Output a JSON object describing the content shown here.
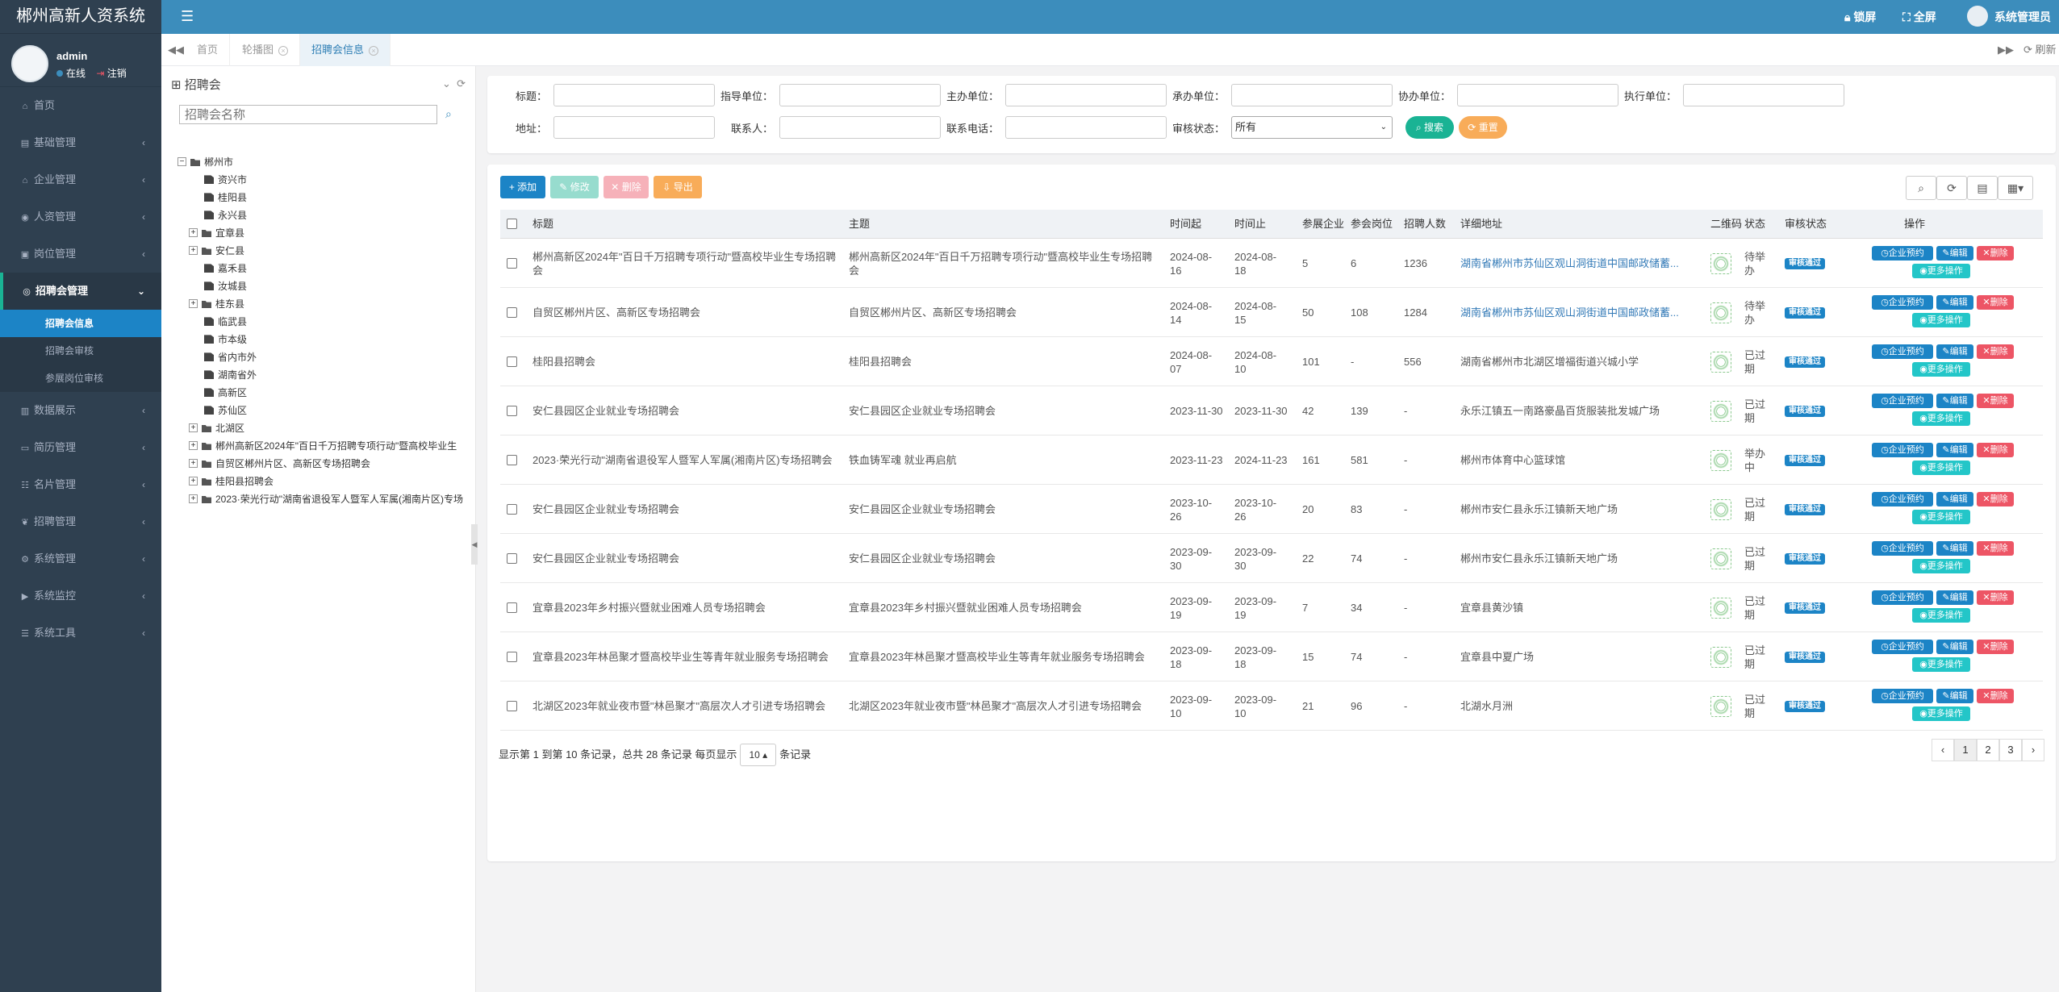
{
  "app": {
    "title": "郴州高新人资系统"
  },
  "header": {
    "menu_icon": "bars-icon",
    "lock_label": "锁屏",
    "fullscreen_label": "全屏",
    "user_label": "系统管理员"
  },
  "user": {
    "name": "admin",
    "status": "在线",
    "logout": "注销"
  },
  "sidebar": {
    "home": "首页",
    "items": [
      {
        "label": "基础管理",
        "icon": "building-icon"
      },
      {
        "label": "企业管理",
        "icon": "bank-icon"
      },
      {
        "label": "人资管理",
        "icon": "user-circle-icon"
      },
      {
        "label": "岗位管理",
        "icon": "briefcase-icon"
      },
      {
        "label": "招聘会管理",
        "icon": "eye-icon"
      },
      {
        "label": "数据展示",
        "icon": "bar-chart-icon"
      },
      {
        "label": "简历管理",
        "icon": "id-card-icon"
      },
      {
        "label": "名片管理",
        "icon": "users-icon"
      },
      {
        "label": "招聘管理",
        "icon": "leaf-icon"
      },
      {
        "label": "系统管理",
        "icon": "gear-icon"
      },
      {
        "label": "系统监控",
        "icon": "video-icon"
      },
      {
        "label": "系统工具",
        "icon": "list-icon"
      }
    ],
    "sub_items": [
      "招聘会信息",
      "招聘会审核",
      "参展岗位审核"
    ]
  },
  "tabs": {
    "items": [
      "首页",
      "轮播图",
      "招聘会信息"
    ],
    "refresh": "刷新"
  },
  "tree": {
    "title": "招聘会",
    "search_placeholder": "招聘会名称",
    "root": "郴州市",
    "nodes": [
      {
        "label": "资兴市",
        "folder": false
      },
      {
        "label": "桂阳县",
        "folder": false
      },
      {
        "label": "永兴县",
        "folder": false
      },
      {
        "label": "宜章县",
        "folder": true
      },
      {
        "label": "安仁县",
        "folder": true
      },
      {
        "label": "嘉禾县",
        "folder": false
      },
      {
        "label": "汝城县",
        "folder": false
      },
      {
        "label": "桂东县",
        "folder": true
      },
      {
        "label": "临武县",
        "folder": false
      },
      {
        "label": "市本级",
        "folder": false
      },
      {
        "label": "省内市外",
        "folder": false
      },
      {
        "label": "湖南省外",
        "folder": false
      },
      {
        "label": "高新区",
        "folder": false
      },
      {
        "label": "苏仙区",
        "folder": false
      },
      {
        "label": "北湖区",
        "folder": true
      }
    ],
    "roots2": [
      "郴州高新区2024年\"百日千万招聘专项行动\"暨高校毕业生",
      "自贸区郴州片区、高新区专场招聘会",
      "桂阳县招聘会",
      "2023·荣光行动\"湖南省退役军人暨军人军属(湘南片区)专场"
    ]
  },
  "search": {
    "labels": {
      "title": "标题：",
      "guide": "指导单位：",
      "host": "主办单位：",
      "undertake": "承办单位：",
      "assist": "协办单位：",
      "execute": "执行单位：",
      "address": "地址：",
      "contact": "联系人：",
      "phone": "联系电话：",
      "status": "审核状态："
    },
    "status_value": "所有",
    "search_btn": "搜索",
    "reset_btn": "重置"
  },
  "toolbar": {
    "add": "添加",
    "edit": "修改",
    "delete": "删除",
    "export": "导出"
  },
  "table": {
    "headers": [
      "标题",
      "主题",
      "时间起",
      "时间止",
      "参展企业",
      "参会岗位",
      "招聘人数",
      "详细地址",
      "二维码",
      "状态",
      "审核状态",
      "操作"
    ],
    "rows": [
      {
        "title": "郴州高新区2024年\"百日千万招聘专项行动\"暨高校毕业生专场招聘会",
        "theme": "郴州高新区2024年\"百日千万招聘专项行动\"暨高校毕业生专场招聘会",
        "start": "2024-08-16",
        "end": "2024-08-18",
        "companies": "5",
        "posts": "6",
        "people": "1236",
        "address": "湖南省郴州市苏仙区观山洞街道中国邮政储蓄...",
        "is_link": true,
        "status": "待举办",
        "audit": "审核通过"
      },
      {
        "title": "自贸区郴州片区、高新区专场招聘会",
        "theme": "自贸区郴州片区、高新区专场招聘会",
        "start": "2024-08-14",
        "end": "2024-08-15",
        "companies": "50",
        "posts": "108",
        "people": "1284",
        "address": "湖南省郴州市苏仙区观山洞街道中国邮政储蓄...",
        "is_link": true,
        "status": "待举办",
        "audit": "审核通过"
      },
      {
        "title": "桂阳县招聘会",
        "theme": "桂阳县招聘会",
        "start": "2024-08-07",
        "end": "2024-08-10",
        "companies": "101",
        "posts": "-",
        "people": "556",
        "address": "湖南省郴州市北湖区增福街道兴城小学",
        "is_link": false,
        "status": "已过期",
        "audit": "审核通过"
      },
      {
        "title": "安仁县园区企业就业专场招聘会",
        "theme": "安仁县园区企业就业专场招聘会",
        "start": "2023-11-30",
        "end": "2023-11-30",
        "companies": "42",
        "posts": "139",
        "people": "-",
        "address": "永乐江镇五一南路豪晶百货服装批发城广场",
        "is_link": false,
        "status": "已过期",
        "audit": "审核通过"
      },
      {
        "title": "2023·荣光行动\"湖南省退役军人暨军人军属(湘南片区)专场招聘会",
        "theme": "铁血铸军魂 就业再启航",
        "start": "2023-11-23",
        "end": "2024-11-23",
        "companies": "161",
        "posts": "581",
        "people": "-",
        "address": "郴州市体育中心篮球馆",
        "is_link": false,
        "status": "举办中",
        "audit": "审核通过"
      },
      {
        "title": "安仁县园区企业就业专场招聘会",
        "theme": "安仁县园区企业就业专场招聘会",
        "start": "2023-10-26",
        "end": "2023-10-26",
        "companies": "20",
        "posts": "83",
        "people": "-",
        "address": "郴州市安仁县永乐江镇新天地广场",
        "is_link": false,
        "status": "已过期",
        "audit": "审核通过"
      },
      {
        "title": "安仁县园区企业就业专场招聘会",
        "theme": "安仁县园区企业就业专场招聘会",
        "start": "2023-09-30",
        "end": "2023-09-30",
        "companies": "22",
        "posts": "74",
        "people": "-",
        "address": "郴州市安仁县永乐江镇新天地广场",
        "is_link": false,
        "status": "已过期",
        "audit": "审核通过"
      },
      {
        "title": "宜章县2023年乡村振兴暨就业困难人员专场招聘会",
        "theme": "宜章县2023年乡村振兴暨就业困难人员专场招聘会",
        "start": "2023-09-19",
        "end": "2023-09-19",
        "companies": "7",
        "posts": "34",
        "people": "-",
        "address": "宜章县黄沙镇",
        "is_link": false,
        "status": "已过期",
        "audit": "审核通过"
      },
      {
        "title": "宜章县2023年林邑聚才暨高校毕业生等青年就业服务专场招聘会",
        "theme": "宜章县2023年林邑聚才暨高校毕业生等青年就业服务专场招聘会",
        "start": "2023-09-18",
        "end": "2023-09-18",
        "companies": "15",
        "posts": "74",
        "people": "-",
        "address": "宜章县中夏广场",
        "is_link": false,
        "status": "已过期",
        "audit": "审核通过"
      },
      {
        "title": "北湖区2023年就业夜市暨\"林邑聚才\"高层次人才引进专场招聘会",
        "theme": "北湖区2023年就业夜市暨\"林邑聚才\"高层次人才引进专场招聘会",
        "start": "2023-09-10",
        "end": "2023-09-10",
        "companies": "21",
        "posts": "96",
        "people": "-",
        "address": "北湖水月洲",
        "is_link": false,
        "status": "已过期",
        "audit": "审核通过"
      }
    ],
    "actions": {
      "reserve": "企业预约",
      "edit": "编辑",
      "delete": "删除",
      "more": "更多操作"
    }
  },
  "pagination": {
    "info_prefix": "显示第 1 到第 10 条记录，总共 28 条记录  每页显示",
    "page_size": "10",
    "info_suffix": "条记录",
    "pages": [
      "‹",
      "1",
      "2",
      "3",
      "›"
    ]
  },
  "colors": {
    "topbar": "#3c8dbc",
    "sidebar": "#2f4050",
    "primary": "#1c84c6",
    "success": "#1ab394",
    "info": "#23c6c8",
    "warning": "#f8ac59",
    "danger": "#ed5565"
  }
}
